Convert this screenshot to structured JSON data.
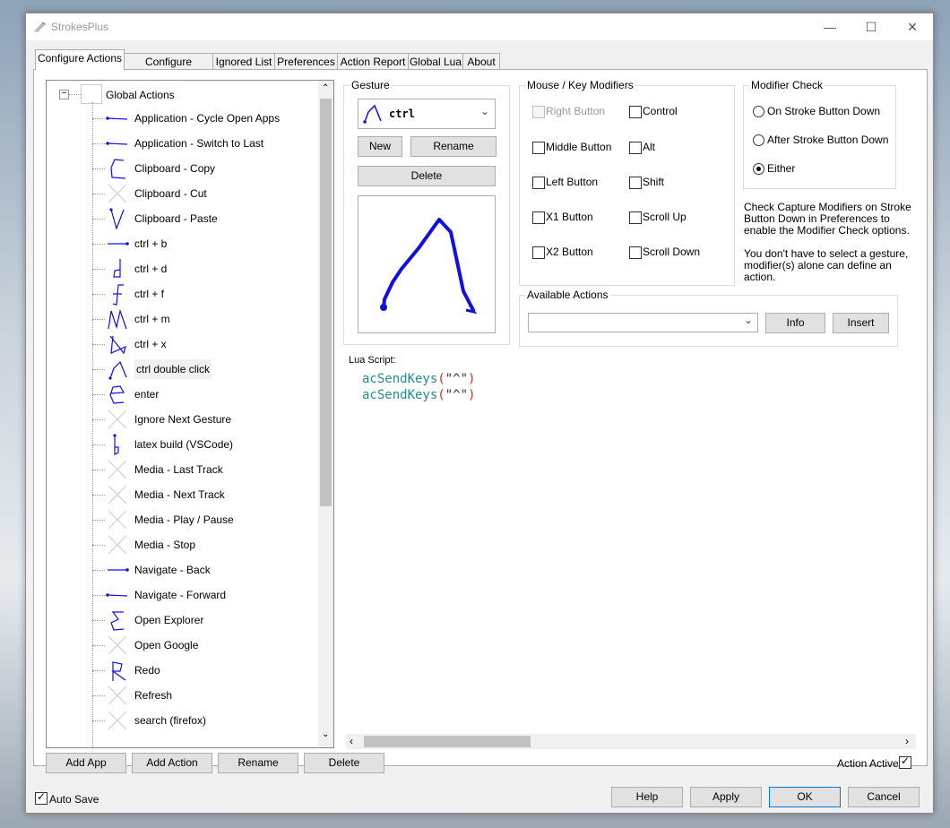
{
  "window": {
    "title": "StrokesPlus"
  },
  "tabs": [
    "Configure Actions",
    "Configure Hotkeys",
    "Ignored List",
    "Preferences",
    "Action Report",
    "Global Lua",
    "About"
  ],
  "tree": {
    "root_label": "Global Actions",
    "items": [
      {
        "label": "Application - Cycle Open Apps",
        "icon": "line-right-icon"
      },
      {
        "label": "Application - Switch to Last",
        "icon": "line-right-icon"
      },
      {
        "label": "Clipboard - Copy",
        "icon": "c-gesture-icon"
      },
      {
        "label": "Clipboard - Cut",
        "icon": "x-placeholder-icon"
      },
      {
        "label": "Clipboard - Paste",
        "icon": "v-gesture-icon"
      },
      {
        "label": "ctrl + b",
        "icon": "line-left-icon"
      },
      {
        "label": "ctrl + d",
        "icon": "d-gesture-icon"
      },
      {
        "label": "ctrl + f",
        "icon": "f-gesture-icon"
      },
      {
        "label": "ctrl + m",
        "icon": "m-gesture-icon"
      },
      {
        "label": "ctrl + x",
        "icon": "x-gesture-icon"
      },
      {
        "label": "ctrl double click",
        "icon": "caret-gesture-icon"
      },
      {
        "label": "enter",
        "icon": "e-gesture-icon"
      },
      {
        "label": "Ignore Next Gesture",
        "icon": "x-placeholder-icon"
      },
      {
        "label": "latex build (VSCode)",
        "icon": "b-gesture-icon"
      },
      {
        "label": "Media - Last Track",
        "icon": "x-placeholder-icon"
      },
      {
        "label": "Media - Next Track",
        "icon": "x-placeholder-icon"
      },
      {
        "label": "Media - Play / Pause",
        "icon": "x-placeholder-icon"
      },
      {
        "label": "Media - Stop",
        "icon": "x-placeholder-icon"
      },
      {
        "label": "Navigate - Back",
        "icon": "line-left-icon"
      },
      {
        "label": "Navigate - Forward",
        "icon": "line-right-icon"
      },
      {
        "label": "Open Explorer",
        "icon": "epsilon-gesture-icon"
      },
      {
        "label": "Open Google",
        "icon": "x-placeholder-icon"
      },
      {
        "label": "Redo",
        "icon": "r-gesture-icon"
      },
      {
        "label": "Refresh",
        "icon": "x-placeholder-icon"
      },
      {
        "label": "search (firefox)",
        "icon": "x-placeholder-icon"
      }
    ],
    "selected_index": 10
  },
  "tree_buttons": {
    "add_app": "Add App",
    "add_action": "Add Action",
    "rename": "Rename",
    "delete": "Delete"
  },
  "gesture": {
    "title": "Gesture",
    "selected": "ctrl",
    "new_label": "New",
    "rename_label": "Rename",
    "delete_label": "Delete"
  },
  "modifiers": {
    "title": "Mouse / Key Modifiers",
    "left_col": [
      {
        "label": "Right Button",
        "disabled": true
      },
      {
        "label": "Middle Button",
        "disabled": false
      },
      {
        "label": "Left Button",
        "disabled": false
      },
      {
        "label": "X1 Button",
        "disabled": false
      },
      {
        "label": "X2 Button",
        "disabled": false
      }
    ],
    "right_col": [
      {
        "label": "Control"
      },
      {
        "label": "Alt"
      },
      {
        "label": "Shift"
      },
      {
        "label": "Scroll Up"
      },
      {
        "label": "Scroll Down"
      }
    ]
  },
  "modifier_check": {
    "title": "Modifier Check",
    "options": [
      "On Stroke Button Down",
      "After Stroke Button Down",
      "Either"
    ],
    "selected_index": 2,
    "note1": "Check Capture Modifiers on Stroke Button Down in Preferences to enable the Modifier Check options.",
    "note2": "You don't have to select a gesture, modifier(s) alone can define an action."
  },
  "available_actions": {
    "title": "Available Actions",
    "value": "",
    "info_label": "Info",
    "insert_label": "Insert"
  },
  "lua": {
    "label": "Lua Script:",
    "lines": [
      {
        "fn": "acSendKeys",
        "open": "(",
        "arg": "\"^\"",
        "close": ")"
      },
      {
        "fn": "acSendKeys",
        "open": "(",
        "arg": "\"^\"",
        "close": ")"
      }
    ]
  },
  "action_active": {
    "label": "Action Active",
    "checked": true
  },
  "footer": {
    "auto_save": "Auto Save",
    "auto_save_checked": true,
    "help": "Help",
    "apply": "Apply",
    "ok": "OK",
    "cancel": "Cancel"
  },
  "colors": {
    "gesture_blue": "#1010e0",
    "selection_bg": "#f0f0f0"
  }
}
